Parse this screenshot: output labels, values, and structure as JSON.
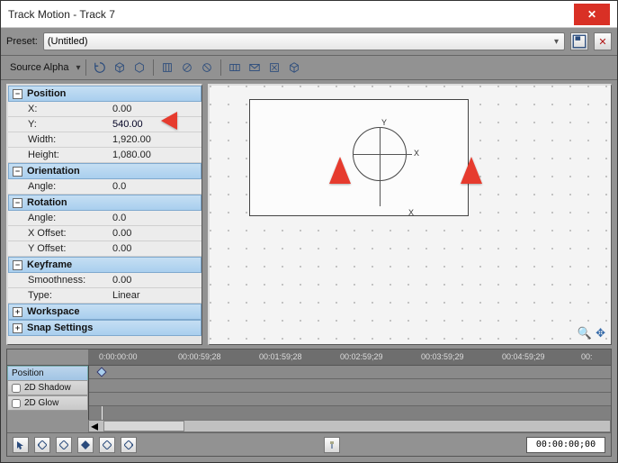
{
  "window": {
    "title": "Track Motion - Track 7"
  },
  "preset": {
    "label": "Preset:",
    "value": "(Untitled)"
  },
  "toolbar": {
    "source_alpha": "Source Alpha"
  },
  "sections": {
    "position": {
      "title": "Position",
      "x_label": "X:",
      "x_value": "0.00",
      "y_label": "Y:",
      "y_value": "540.00",
      "w_label": "Width:",
      "w_value": "1,920.00",
      "h_label": "Height:",
      "h_value": "1,080.00"
    },
    "orientation": {
      "title": "Orientation",
      "angle_label": "Angle:",
      "angle_value": "0.0"
    },
    "rotation": {
      "title": "Rotation",
      "angle_label": "Angle:",
      "angle_value": "0.0",
      "xoff_label": "X Offset:",
      "xoff_value": "0.00",
      "yoff_label": "Y Offset:",
      "yoff_value": "0.00"
    },
    "keyframe": {
      "title": "Keyframe",
      "smooth_label": "Smoothness:",
      "smooth_value": "0.00",
      "type_label": "Type:",
      "type_value": "Linear"
    },
    "workspace": {
      "title": "Workspace"
    },
    "snap": {
      "title": "Snap Settings"
    }
  },
  "canvas": {
    "y_label": "Y",
    "x_label": "X",
    "x2_label": "X"
  },
  "timeline": {
    "ticks": [
      "0:00:00:00",
      "00:00:59;28",
      "00:01:59;28",
      "00:02:59;29",
      "00:03:59;29",
      "00:04:59;29",
      "00:"
    ],
    "tracks": {
      "position": "Position",
      "shadow": "2D Shadow",
      "glow": "2D Glow"
    },
    "counter": "00:00:00;00"
  }
}
